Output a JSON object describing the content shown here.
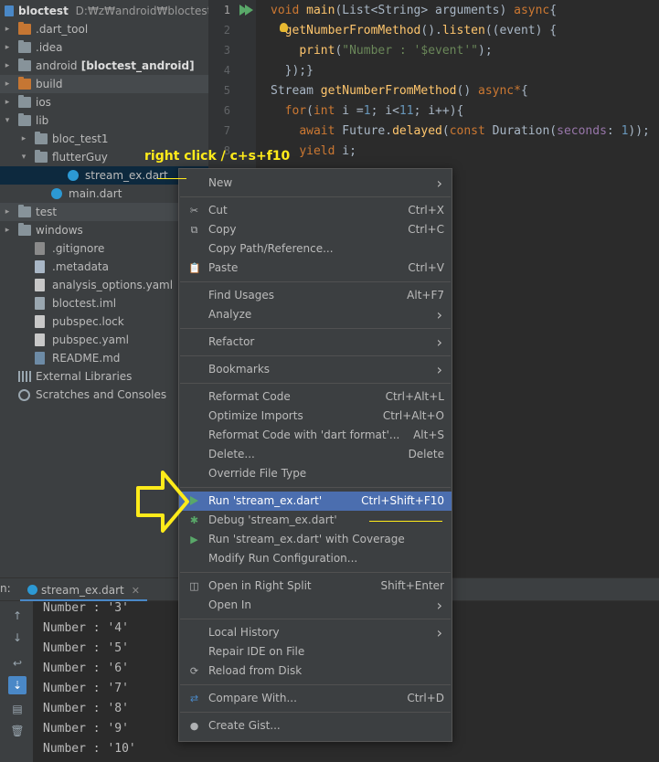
{
  "project": {
    "name": "bloctest",
    "path": "D:₩z₩android₩bloctest"
  },
  "tree": [
    {
      "label": ".dart_tool",
      "indent": 0,
      "type": "folder-orange",
      "arrow": "right"
    },
    {
      "label": ".idea",
      "indent": 0,
      "type": "folder",
      "arrow": "right"
    },
    {
      "label": "android",
      "bold": "[bloctest_android]",
      "indent": 0,
      "type": "folder",
      "arrow": "right"
    },
    {
      "label": "build",
      "indent": 0,
      "type": "folder-orange",
      "arrow": "right"
    },
    {
      "label": "ios",
      "indent": 0,
      "type": "folder",
      "arrow": "right"
    },
    {
      "label": "lib",
      "indent": 0,
      "type": "folder",
      "arrow": "down"
    },
    {
      "label": "bloc_test1",
      "indent": 1,
      "type": "folder",
      "arrow": "right"
    },
    {
      "label": "flutterGuy",
      "indent": 1,
      "type": "folder",
      "arrow": "down"
    },
    {
      "label": "stream_ex.dart",
      "indent": 3,
      "type": "dart"
    },
    {
      "label": "main.dart",
      "indent": 2,
      "type": "dart"
    },
    {
      "label": "test",
      "indent": 0,
      "type": "folder",
      "arrow": "right"
    },
    {
      "label": "windows",
      "indent": 0,
      "type": "folder",
      "arrow": "right"
    },
    {
      "label": ".gitignore",
      "indent": 1,
      "type": "git"
    },
    {
      "label": ".metadata",
      "indent": 1,
      "type": "file"
    },
    {
      "label": "analysis_options.yaml",
      "indent": 1,
      "type": "yaml"
    },
    {
      "label": "bloctest.iml",
      "indent": 1,
      "type": "iml"
    },
    {
      "label": "pubspec.lock",
      "indent": 1,
      "type": "yaml"
    },
    {
      "label": "pubspec.yaml",
      "indent": 1,
      "type": "yaml"
    },
    {
      "label": "README.md",
      "indent": 1,
      "type": "md"
    },
    {
      "label": "External Libraries",
      "indent": 0,
      "type": "lib"
    },
    {
      "label": "Scratches and Consoles",
      "indent": 0,
      "type": "scratch"
    }
  ],
  "editor": {
    "line_numbers": [
      "1",
      "2",
      "3",
      "4",
      "5",
      "6",
      "7",
      "8"
    ],
    "lines": [
      "void main(List<String> arguments) async{",
      "  getNumberFromMethod().listen((event) {",
      "    print(\"Number : '$event'\");",
      "  });}",
      "Stream getNumberFromMethod() async*{",
      "  for(int i =1; i<11; i++){",
      "    await Future.delayed(const Duration(seconds: 1));",
      "    yield i;"
    ]
  },
  "annotation": {
    "text": "right click / c+s+f10"
  },
  "context_menu": [
    {
      "label": "New",
      "submenu": true
    },
    {
      "sep": true
    },
    {
      "label": "Cut",
      "shortcut": "Ctrl+X",
      "icon": "scissors-icon"
    },
    {
      "label": "Copy",
      "shortcut": "Ctrl+C",
      "icon": "copy-icon"
    },
    {
      "label": "Copy Path/Reference..."
    },
    {
      "label": "Paste",
      "shortcut": "Ctrl+V",
      "icon": "paste-icon"
    },
    {
      "sep": true
    },
    {
      "label": "Find Usages",
      "shortcut": "Alt+F7"
    },
    {
      "label": "Analyze",
      "submenu": true
    },
    {
      "sep": true
    },
    {
      "label": "Refactor",
      "submenu": true
    },
    {
      "sep": true
    },
    {
      "label": "Bookmarks",
      "submenu": true
    },
    {
      "sep": true
    },
    {
      "label": "Reformat Code",
      "shortcut": "Ctrl+Alt+L"
    },
    {
      "label": "Optimize Imports",
      "shortcut": "Ctrl+Alt+O"
    },
    {
      "label": "Reformat Code with 'dart format'...",
      "shortcut": "Alt+S"
    },
    {
      "label": "Delete...",
      "shortcut": "Delete"
    },
    {
      "label": "Override File Type"
    },
    {
      "sep": true
    },
    {
      "label": "Run 'stream_ex.dart'",
      "shortcut": "Ctrl+Shift+F10",
      "icon": "run-icon",
      "active": true
    },
    {
      "label": "Debug 'stream_ex.dart'",
      "icon": "debug-icon"
    },
    {
      "label": "Run 'stream_ex.dart' with Coverage",
      "icon": "coverage-icon"
    },
    {
      "label": "Modify Run Configuration..."
    },
    {
      "sep": true
    },
    {
      "label": "Open in Right Split",
      "shortcut": "Shift+Enter",
      "icon": "split-icon"
    },
    {
      "label": "Open In",
      "submenu": true
    },
    {
      "sep": true
    },
    {
      "label": "Local History",
      "submenu": true
    },
    {
      "label": "Repair IDE on File"
    },
    {
      "label": "Reload from Disk",
      "icon": "reload-icon"
    },
    {
      "sep": true
    },
    {
      "label": "Compare With...",
      "shortcut": "Ctrl+D",
      "icon": "compare-icon"
    },
    {
      "sep": true
    },
    {
      "label": "Create Gist...",
      "icon": "github-icon"
    }
  ],
  "run_panel": {
    "label": "n:",
    "tab": "stream_ex.dart",
    "output": [
      "Number : '3'",
      "Number : '4'",
      "Number : '5'",
      "Number : '6'",
      "Number : '7'",
      "Number : '8'",
      "Number : '9'",
      "Number : '10'"
    ]
  },
  "colors": {
    "accent": "#4b6eaf",
    "annotation": "#ffeb1a",
    "run_green": "#59a869"
  }
}
